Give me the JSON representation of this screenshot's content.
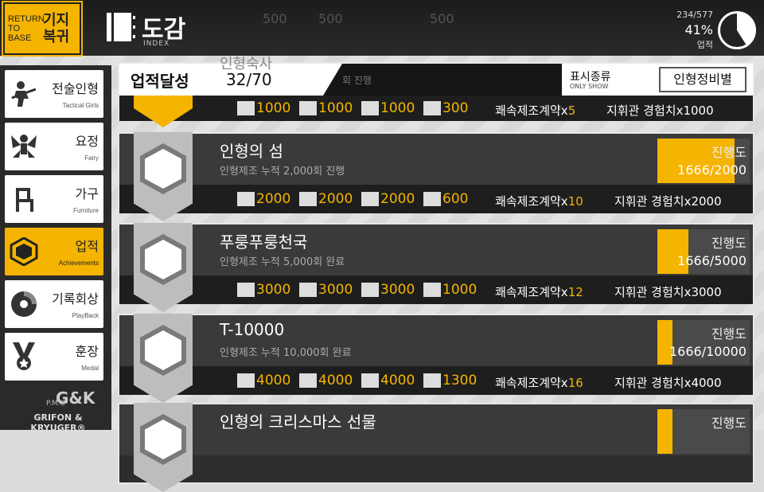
{
  "header": {
    "back_en": "RETURN TO BASE",
    "back_ko": "기지 복귀",
    "title": "도감",
    "subtitle": "INDEX",
    "progress_count": "234/577",
    "progress_pct": "41%",
    "progress_label": "업적",
    "progress_fraction": 0.41,
    "bg_values": [
      "500",
      "500",
      "500"
    ]
  },
  "sidebar": {
    "items": [
      {
        "ko": "전술인형",
        "en": "Tactical Girls",
        "icon": "rifle-girl-icon"
      },
      {
        "ko": "요정",
        "en": "Fairy",
        "icon": "fairy-icon"
      },
      {
        "ko": "가구",
        "en": "Furniture",
        "icon": "chair-icon"
      },
      {
        "ko": "업적",
        "en": "Achievements",
        "icon": "achievement-icon"
      },
      {
        "ko": "기록회상",
        "en": "PlayBack",
        "icon": "disc-icon"
      },
      {
        "ko": "훈장",
        "en": "Medal",
        "icon": "medal-icon"
      }
    ],
    "logo_a": "P.M.C",
    "logo_b": "G&K",
    "logo_c": "GRIFON & KRYUGER®"
  },
  "summary": {
    "title": "업적달성",
    "count": "32/70",
    "bg_title": "인형숙사",
    "bg_desc": "회 진행",
    "show_label": "표시종류",
    "show_en": "ONLY SHOW",
    "filter": "인형정비별",
    "rewards": {
      "manpower": "1000",
      "ammo": "1000",
      "rations": "1000",
      "parts": "300",
      "contract": "쾌속제조계약x",
      "contract_n": "5",
      "exp": "지휘관 경험치x1000"
    }
  },
  "cards": [
    {
      "name": "인형의 섬",
      "desc": "인형제조 누적 2,000회 진행",
      "prog_label": "진행도",
      "prog": "1666/2000",
      "fraction": 0.833,
      "manpower": "2000",
      "ammo": "2000",
      "rations": "2000",
      "parts": "600",
      "contract": "쾌속제조계약x",
      "contract_n": "10",
      "exp": "지휘관 경험치x2000"
    },
    {
      "name": "푸룽푸룽천국",
      "desc": "인형제조 누적 5,000회 완료",
      "prog_label": "진행도",
      "prog": "1666/5000",
      "fraction": 0.333,
      "manpower": "3000",
      "ammo": "3000",
      "rations": "3000",
      "parts": "1000",
      "contract": "쾌속제조계약x",
      "contract_n": "12",
      "exp": "지휘관 경험치x3000"
    },
    {
      "name": "T-10000",
      "desc": "인형제조 누적 10,000회 완료",
      "prog_label": "진행도",
      "prog": "1666/10000",
      "fraction": 0.167,
      "manpower": "4000",
      "ammo": "4000",
      "rations": "4000",
      "parts": "1300",
      "contract": "쾌속제조계약x",
      "contract_n": "16",
      "exp": "지휘관 경험치x4000"
    },
    {
      "name": "인형의 크리스마스 선물",
      "desc": "",
      "prog_label": "진행도",
      "prog": "",
      "fraction": 0.167
    }
  ],
  "colors": {
    "accent": "#f4b400",
    "panel": "#2d2d2d"
  }
}
